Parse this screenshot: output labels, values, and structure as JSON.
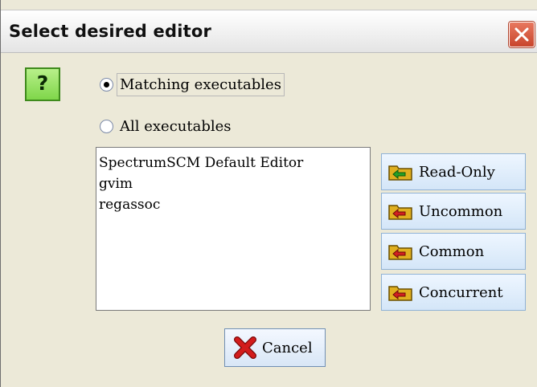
{
  "window": {
    "title": "Select desired editor"
  },
  "icon": {
    "question_glyph": "?"
  },
  "options": {
    "matching_label": "Matching executables",
    "all_label": "All executables",
    "selected": "matching"
  },
  "editors": [
    "SpectrumSCM Default Editor",
    "gvim",
    "regassoc"
  ],
  "side_buttons": [
    {
      "label": "Read-Only",
      "icon": "folder-green-arrow-icon"
    },
    {
      "label": "Uncommon",
      "icon": "folder-red-arrow-icon"
    },
    {
      "label": "Common",
      "icon": "folder-red-arrow-icon"
    },
    {
      "label": "Concurrent",
      "icon": "folder-red-arrow-icon"
    }
  ],
  "cancel": {
    "label": "Cancel",
    "icon": "red-x-icon"
  },
  "colors": {
    "question_bg": "#7fd64a",
    "close_bg": "#c8452c",
    "folder": "#e0b020",
    "cancel_x": "#d21b1b"
  }
}
